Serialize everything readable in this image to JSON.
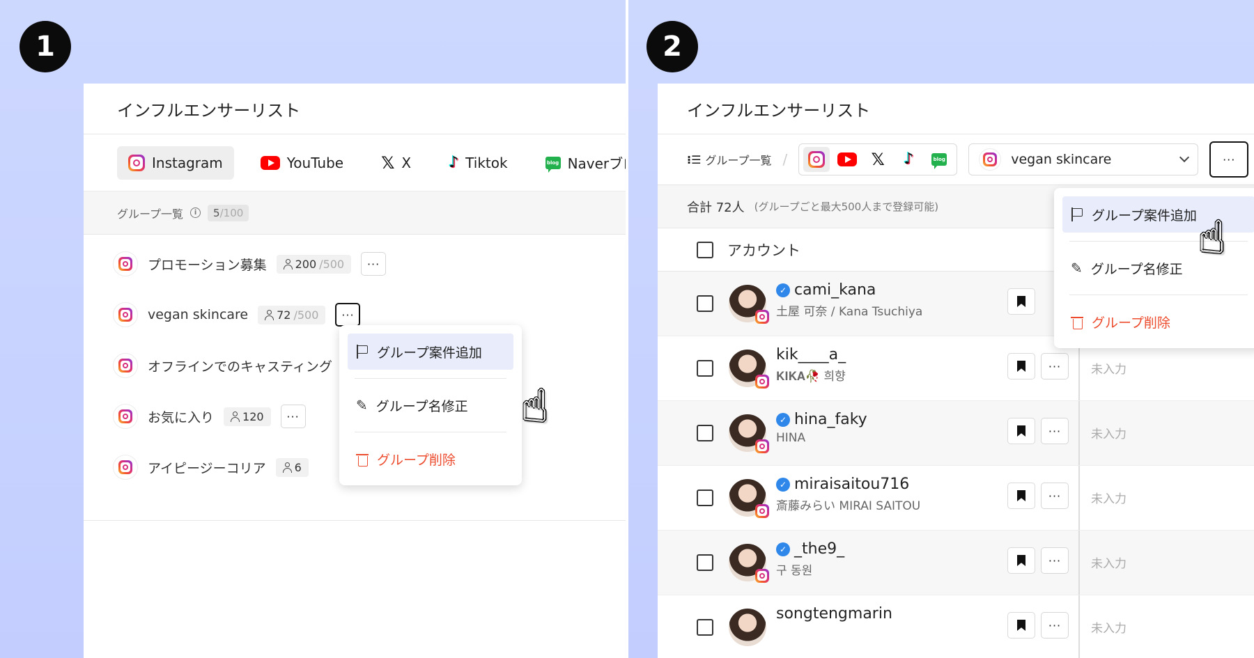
{
  "steps": [
    "1",
    "2"
  ],
  "panel1": {
    "title": "インフルエンサーリスト",
    "tabs": [
      {
        "label": "Instagram",
        "icon": "instagram-icon",
        "active": true
      },
      {
        "label": "YouTube",
        "icon": "youtube-icon"
      },
      {
        "label": "X",
        "icon": "x-icon"
      },
      {
        "label": "Tiktok",
        "icon": "tiktok-icon"
      },
      {
        "label": "Naverブログ",
        "icon": "naver-blog-icon"
      }
    ],
    "group_header": {
      "label": "グループ一覧",
      "count": "5",
      "max": "/100"
    },
    "groups": [
      {
        "name": "プロモーション募集",
        "count": "200",
        "max": "/500",
        "more": "···"
      },
      {
        "name": "vegan skincare",
        "count": "72",
        "max": "/500",
        "more": "···"
      },
      {
        "name": "オフラインでのキャスティング",
        "count": "",
        "max": "",
        "more": ""
      },
      {
        "name": "お気に入り",
        "count": "120",
        "max": "",
        "more": "···"
      },
      {
        "name": "アイピージーコリア",
        "count": "6",
        "max": "",
        "more": ""
      }
    ],
    "menu": {
      "add": "グループ案件追加",
      "rename": "グループ名修正",
      "delete": "グループ削除"
    }
  },
  "panel2": {
    "title": "インフルエンサーリスト",
    "group_list_label": "グループ一覧",
    "slash": "/",
    "selected_group": "vegan skincare",
    "more": "···",
    "summary": {
      "total": "合計 72人",
      "note": "(グループごと最大500人まで登録可能)"
    },
    "column_account": "アカウント",
    "empty_text": "未入力",
    "rows": [
      {
        "username": "cami_kana",
        "display": "土屋 可奈 / Kana Tsuchiya",
        "verified": true
      },
      {
        "username": "kik____a_",
        "display": "𝐊𝐈𝐊𝐀🥀 희향",
        "verified": false
      },
      {
        "username": "hina_faky",
        "display": "HINA",
        "verified": true
      },
      {
        "username": "miraisaitou716",
        "display": "斎藤みらい MIRAI SAITOU",
        "verified": true
      },
      {
        "username": "_the9_",
        "display": "구 동원",
        "verified": true
      },
      {
        "username": "songtengmarin",
        "display": "",
        "verified": false
      }
    ],
    "menu": {
      "add": "グループ案件追加",
      "rename": "グループ名修正",
      "delete": "グループ削除"
    }
  },
  "colors": {
    "background": "#c8d3ff",
    "accent_menu": "#e8ecfb",
    "danger": "#ec4b2d",
    "verified": "#2f87ea"
  }
}
